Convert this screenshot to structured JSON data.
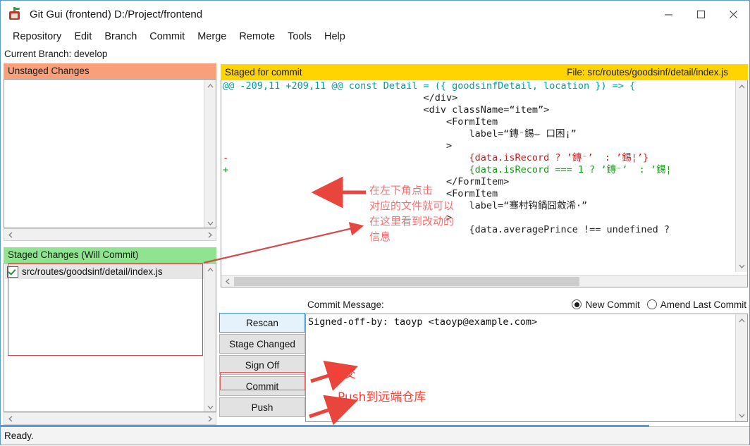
{
  "window": {
    "title": "Git Gui (frontend) D:/Project/frontend",
    "app_icon": "git-gui-icon",
    "minimize_icon": "minimize-icon",
    "maximize_icon": "maximize-icon",
    "close_icon": "close-icon"
  },
  "menu": {
    "items": [
      {
        "label": "Repository"
      },
      {
        "label": "Edit"
      },
      {
        "label": "Branch"
      },
      {
        "label": "Commit"
      },
      {
        "label": "Merge"
      },
      {
        "label": "Remote"
      },
      {
        "label": "Tools"
      },
      {
        "label": "Help"
      }
    ]
  },
  "branch_bar": {
    "text": "Current Branch: develop"
  },
  "unstaged": {
    "header": "Unstaged Changes",
    "header_color": "#f9a07a",
    "files": []
  },
  "staged": {
    "header": "Staged Changes (Will Commit)",
    "header_color": "#8fe48f",
    "files": [
      {
        "name": "src/routes/goodsinf/detail/index.js",
        "checked": true
      }
    ]
  },
  "diff": {
    "header_left": "Staged for commit",
    "header_right": "File:  src/routes/goodsinf/detail/index.js",
    "header_color": "#ffd400",
    "lines": [
      {
        "marker": "",
        "kind": "hunk",
        "text": "@@ -209,11 +209,11 @@ const Detail = ({ goodsinfDetail, location }) => {"
      },
      {
        "marker": " ",
        "kind": "ctx",
        "text": "                                  </div>"
      },
      {
        "marker": " ",
        "kind": "ctx",
        "text": "                                  <div className=“item”>"
      },
      {
        "marker": " ",
        "kind": "ctx",
        "text": "                                      <FormItem"
      },
      {
        "marker": " ",
        "kind": "ctx",
        "text": "                                          label=“鏄⁻錫⌣ 口困¡”"
      },
      {
        "marker": " ",
        "kind": "ctx",
        "text": "                                      >"
      },
      {
        "marker": "-",
        "kind": "del",
        "text": "                                          {data.isRecord ? ’鏄⁻’  : ’錫¦’}"
      },
      {
        "marker": "+",
        "kind": "add",
        "text": "                                          {data.isRecord === 1 ? ’鏄⁻’  : ’錫¦"
      },
      {
        "marker": " ",
        "kind": "ctx",
        "text": "                                      </FormItem>"
      },
      {
        "marker": " ",
        "kind": "ctx",
        "text": "                                      <FormItem"
      },
      {
        "marker": " ",
        "kind": "ctx",
        "text": "                                          label=“骞村钩鍋囧敹浠·”"
      },
      {
        "marker": " ",
        "kind": "ctx",
        "text": "                                      >"
      },
      {
        "marker": " ",
        "kind": "ctx",
        "text": "                                          {data.averagePrince !== undefined ?"
      }
    ]
  },
  "buttons": [
    {
      "label": "Rescan",
      "focused": true
    },
    {
      "label": "Stage Changed",
      "focused": false
    },
    {
      "label": "Sign Off",
      "focused": false
    },
    {
      "label": "Commit",
      "focused": false
    },
    {
      "label": "Push",
      "focused": false
    }
  ],
  "commit": {
    "label": "Commit Message:",
    "message": "Signed-off-by: taoyp <taoyp@example.com>",
    "modes": [
      {
        "label": "New Commit",
        "selected": true
      },
      {
        "label": "Amend Last Commit",
        "selected": false
      }
    ]
  },
  "status": {
    "text": "Ready."
  },
  "annotations": {
    "diff_note": "在左下角点击\n对应的文件就可以\n在这里看到改动的\n信息",
    "commit_note": "提交",
    "push_note": "Push到远端仓库",
    "color": "#ff3b30"
  }
}
